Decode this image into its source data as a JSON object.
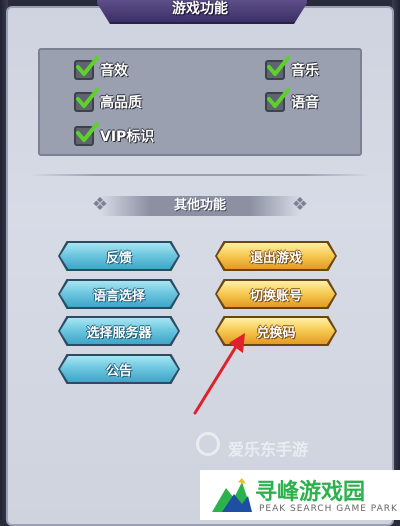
{
  "header": {
    "title": "游戏功能"
  },
  "toggles": [
    {
      "label": "音效",
      "checked": true
    },
    {
      "label": "音乐",
      "checked": true
    },
    {
      "label": "高品质",
      "checked": true
    },
    {
      "label": "语音",
      "checked": true
    },
    {
      "label": "VIP标识",
      "checked": true
    }
  ],
  "section": {
    "title": "其他功能"
  },
  "buttons": {
    "feedback": "反馈",
    "language": "语言选择",
    "server": "选择服务器",
    "notice": "公告",
    "exit": "退出游戏",
    "switch_account": "切换账号",
    "redeem_code": "兑换码"
  },
  "watermark": {
    "text": "爱乐东手游"
  },
  "logo": {
    "main": "寻峰游戏园",
    "sub": "PEAK SEARCH GAME PARK"
  },
  "colors": {
    "accent_green": "#2bb24c",
    "arrow_red": "#e0202a",
    "blue_button": "#6ec7e0",
    "gold_button": "#f6c84e"
  }
}
